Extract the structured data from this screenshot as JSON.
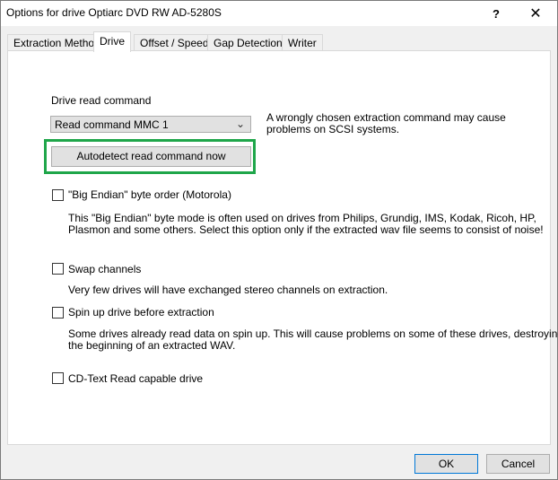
{
  "window": {
    "title": "Options for drive Optiarc DVD RW AD-5280S",
    "help_glyph": "?",
    "close_glyph": "✕"
  },
  "tabs": [
    {
      "label": "Extraction Method",
      "active": false
    },
    {
      "label": "Drive",
      "active": true
    },
    {
      "label": "Offset / Speed",
      "active": false
    },
    {
      "label": "Gap Detection",
      "active": false
    },
    {
      "label": "Writer",
      "active": false
    }
  ],
  "drive": {
    "read_command_label": "Drive read command",
    "read_command_value": "Read command MMC 1",
    "read_command_hint_line1": "A wrongly chosen extraction command may cause",
    "read_command_hint_line2": "problems on SCSI systems.",
    "autodetect_label": "Autodetect read command now",
    "highlight_color": "#1fa64a",
    "options": [
      {
        "label": "\"Big Endian\" byte order (Motorola)",
        "checked": false,
        "desc_line1": "This \"Big Endian\" byte mode is often used on drives from Philips, Grundig, IMS, Kodak, Ricoh, HP,",
        "desc_line2": "Plasmon and some others. Select this option only if the extracted wav file seems to consist of noise!"
      },
      {
        "label": "Swap channels",
        "checked": false,
        "desc_line1": "Very few drives will have exchanged stereo channels on extraction.",
        "desc_line2": ""
      },
      {
        "label": "Spin up drive before extraction",
        "checked": false,
        "desc_line1": "Some drives already read data on spin up. This will cause problems on some of these drives, destroying",
        "desc_line2": "the beginning of an extracted WAV."
      },
      {
        "label": "CD-Text Read capable drive",
        "checked": false,
        "desc_line1": "",
        "desc_line2": ""
      }
    ]
  },
  "footer": {
    "ok_label": "OK",
    "cancel_label": "Cancel"
  }
}
